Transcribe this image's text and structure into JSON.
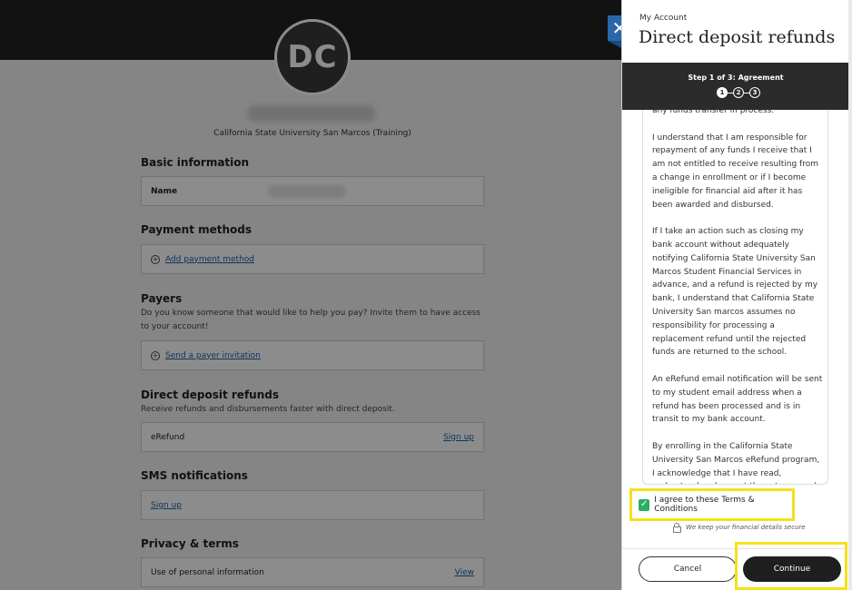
{
  "background": {
    "avatar_initials": "DC",
    "school_name": "California State University San Marcos (Training)",
    "sections": {
      "basic_information": {
        "title": "Basic information",
        "name_label": "Name"
      },
      "payment_methods": {
        "title": "Payment methods",
        "add_link": "Add payment method"
      },
      "payers": {
        "title": "Payers",
        "description": "Do you know someone that would like to help you pay? Invite them to have access to your account!",
        "invite_link": "Send a payer invitation"
      },
      "direct_deposit": {
        "title": "Direct deposit refunds",
        "description": "Receive refunds and disbursements faster with direct deposit.",
        "item_label": "eRefund",
        "signup_link": "Sign up"
      },
      "sms": {
        "title": "SMS notifications",
        "signup_link": "Sign up"
      },
      "privacy": {
        "title": "Privacy & terms",
        "item_label": "Use of personal information",
        "view_link": "View"
      }
    }
  },
  "panel": {
    "kicker": "My Account",
    "title": "Direct deposit refunds",
    "step_label": "Step 1 of 3: Agreement",
    "steps": [
      "1",
      "2",
      "3"
    ],
    "terms_partial_top": "any funds transfer in process.",
    "terms_paragraphs": [
      "I understand that I am responsible for repayment of any funds I receive that I am not entitled to receive resulting from a change in enrollment or if I become ineligible for financial aid after it has been awarded and disbursed.",
      "If I take an action such as closing my bank account without adequately notifying California State University San Marcos Student Financial Services in advance, and a refund is rejected by my bank, I understand that California State University San marcos assumes no responsibility for processing a replacement refund until the rejected funds are returned to the school.",
      "An eRefund email notification will be sent to my student email address when a refund has been processed and is in transit to my bank account.",
      "By enrolling in the California State University San Marcos eRefund program, I acknowledge that I have read, understand and accept these terms and conditions."
    ],
    "agree_label": "I agree to these Terms & Conditions",
    "agree_checked": true,
    "secure_note": "We keep your financial details secure",
    "cancel_label": "Cancel",
    "continue_label": "Continue"
  },
  "colors": {
    "header_dark": "#222222",
    "close_tab": "#2a67a8",
    "checkbox_green": "#2eae63",
    "highlight_yellow": "#f5e11c",
    "link_blue": "#1d5fa8"
  }
}
